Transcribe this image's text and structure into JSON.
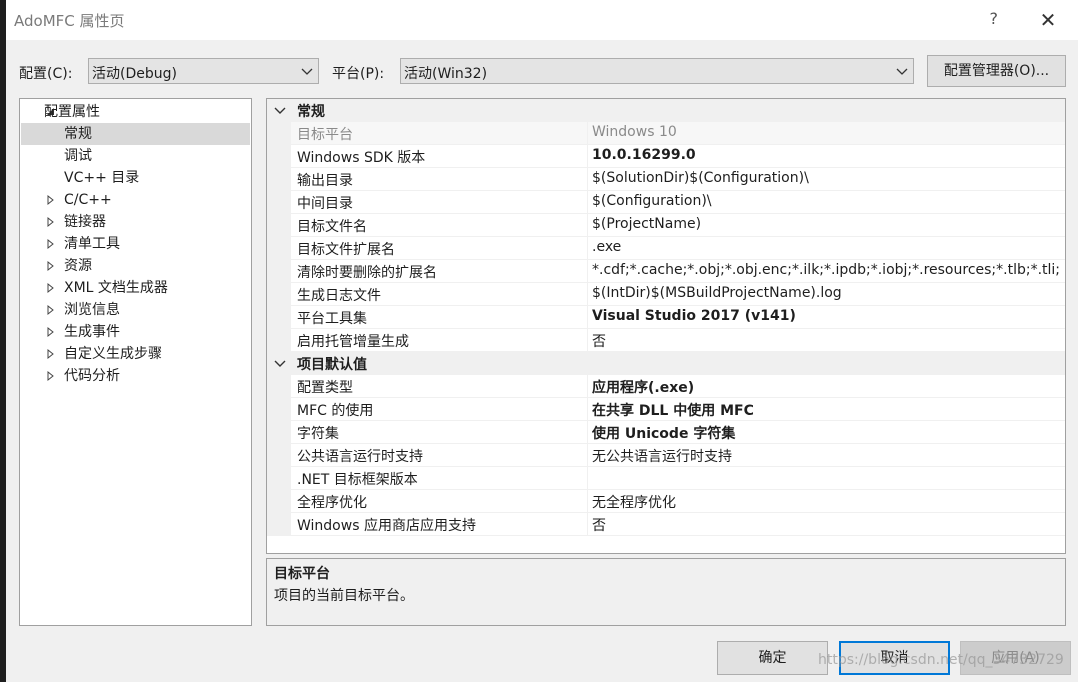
{
  "window": {
    "title": "AdoMFC 属性页",
    "help": "?",
    "close": "✕"
  },
  "toolbar": {
    "config_label": "配置(C):",
    "config_value": "活动(Debug)",
    "platform_label": "平台(P):",
    "platform_value": "活动(Win32)",
    "config_manager_label": "配置管理器(O)..."
  },
  "tree": {
    "root": "配置属性",
    "children": [
      "常规",
      "调试",
      "VC++ 目录"
    ],
    "collapsed": [
      "C/C++",
      "链接器",
      "清单工具",
      "资源",
      "XML 文档生成器",
      "浏览信息",
      "生成事件",
      "自定义生成步骤",
      "代码分析"
    ]
  },
  "grid": {
    "categories": [
      {
        "name": "常规",
        "props": [
          {
            "name": "目标平台",
            "value": "Windows 10"
          },
          {
            "name": "Windows SDK 版本",
            "value": "10.0.16299.0"
          },
          {
            "name": "输出目录",
            "value": "$(SolutionDir)$(Configuration)\\"
          },
          {
            "name": "中间目录",
            "value": "$(Configuration)\\"
          },
          {
            "name": "目标文件名",
            "value": "$(ProjectName)"
          },
          {
            "name": "目标文件扩展名",
            "value": ".exe"
          },
          {
            "name": "清除时要删除的扩展名",
            "value": "*.cdf;*.cache;*.obj;*.obj.enc;*.ilk;*.ipdb;*.iobj;*.resources;*.tlb;*.tli;"
          },
          {
            "name": "生成日志文件",
            "value": "$(IntDir)$(MSBuildProjectName).log"
          },
          {
            "name": "平台工具集",
            "value": "Visual Studio 2017 (v141)"
          },
          {
            "name": "启用托管增量生成",
            "value": "否"
          }
        ]
      },
      {
        "name": "项目默认值",
        "props": [
          {
            "name": "配置类型",
            "value": "应用程序(.exe)"
          },
          {
            "name": "MFC 的使用",
            "value": "在共享 DLL 中使用 MFC"
          },
          {
            "name": "字符集",
            "value": "使用 Unicode 字符集"
          },
          {
            "name": "公共语言运行时支持",
            "value": "无公共语言运行时支持"
          },
          {
            "name": ".NET 目标框架版本",
            "value": ""
          },
          {
            "name": "全程序优化",
            "value": "无全程序优化"
          },
          {
            "name": "Windows 应用商店应用支持",
            "value": "否"
          }
        ]
      }
    ]
  },
  "description": {
    "title": "目标平台",
    "text": "项目的当前目标平台。"
  },
  "buttons": {
    "ok": "确定",
    "cancel": "取消",
    "apply": "应用(A)"
  },
  "watermark": "https://blog.csdn.net/qq_34732729",
  "colors": {
    "selection": "#d9d9d9",
    "border": "#a0a0a0",
    "panel": "#f0f0f0",
    "focus_border": "#0078d7"
  }
}
